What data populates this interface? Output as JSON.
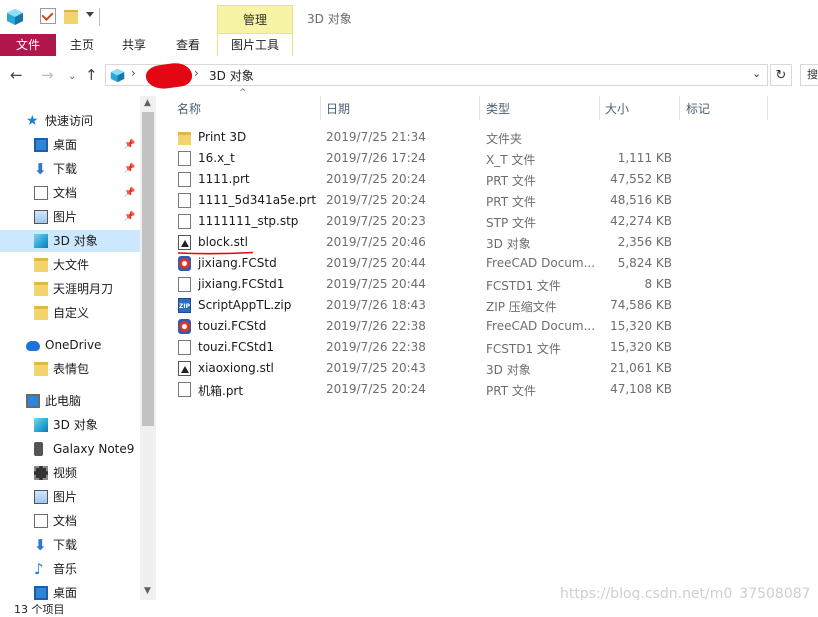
{
  "window": {
    "title": "3D 对象",
    "contextual_tab": "管理"
  },
  "ribbon": {
    "tabs": [
      "文件",
      "主页",
      "共享",
      "查看",
      "图片工具"
    ]
  },
  "address": {
    "path_current": "3D 对象"
  },
  "nav": {
    "items": [
      {
        "label": "快速访问",
        "icon": "star-icon"
      },
      {
        "label": "桌面",
        "icon": "desktop-icon",
        "pinned": true
      },
      {
        "label": "下载",
        "icon": "download-icon",
        "pinned": true
      },
      {
        "label": "文档",
        "icon": "document-icon",
        "pinned": true
      },
      {
        "label": "图片",
        "icon": "picture-icon",
        "pinned": true
      },
      {
        "label": "3D 对象",
        "icon": "cube-icon",
        "selected": true
      },
      {
        "label": "大文件",
        "icon": "folder-icon"
      },
      {
        "label": "天涯明月刀",
        "icon": "folder-icon"
      },
      {
        "label": "自定义",
        "icon": "folder-icon"
      },
      {
        "label": "OneDrive",
        "icon": "cloud-icon"
      },
      {
        "label": "表情包",
        "icon": "folder-icon"
      },
      {
        "label": "此电脑",
        "icon": "computer-icon"
      },
      {
        "label": "3D 对象",
        "icon": "cube-icon"
      },
      {
        "label": "Galaxy Note9",
        "icon": "phone-icon"
      },
      {
        "label": "视频",
        "icon": "video-icon"
      },
      {
        "label": "图片",
        "icon": "picture-icon"
      },
      {
        "label": "文档",
        "icon": "document-icon"
      },
      {
        "label": "下载",
        "icon": "download-icon"
      },
      {
        "label": "音乐",
        "icon": "music-icon"
      },
      {
        "label": "桌面",
        "icon": "desktop-icon"
      }
    ]
  },
  "columns": {
    "name": "名称",
    "date": "日期",
    "type": "类型",
    "size": "大小",
    "tags": "标记"
  },
  "files": [
    {
      "name": "Print 3D",
      "date": "2019/7/25 21:34",
      "type": "文件夹",
      "size": "",
      "icon": "folder-icon"
    },
    {
      "name": "16.x_t",
      "date": "2019/7/26 17:24",
      "type": "X_T 文件",
      "size": "1,111 KB",
      "icon": "file-icon"
    },
    {
      "name": "1111.prt",
      "date": "2019/7/25 20:24",
      "type": "PRT 文件",
      "size": "47,552 KB",
      "icon": "file-icon"
    },
    {
      "name": "1111_5d341a5e.prt",
      "date": "2019/7/25 20:24",
      "type": "PRT 文件",
      "size": "48,516 KB",
      "icon": "file-icon"
    },
    {
      "name": "1111111_stp.stp",
      "date": "2019/7/25 20:23",
      "type": "STP 文件",
      "size": "42,274 KB",
      "icon": "file-icon"
    },
    {
      "name": "block.stl",
      "date": "2019/7/25 20:46",
      "type": "3D 对象",
      "size": "2,356 KB",
      "icon": "stl-icon"
    },
    {
      "name": "jixiang.FCStd",
      "date": "2019/7/25 20:44",
      "type": "FreeCAD Docum...",
      "size": "5,824 KB",
      "icon": "freecad-icon"
    },
    {
      "name": "jixiang.FCStd1",
      "date": "2019/7/25 20:44",
      "type": "FCSTD1 文件",
      "size": "8 KB",
      "icon": "file-icon"
    },
    {
      "name": "ScriptAppTL.zip",
      "date": "2019/7/26 18:43",
      "type": "ZIP 压缩文件",
      "size": "74,586 KB",
      "icon": "zip-icon"
    },
    {
      "name": "touzi.FCStd",
      "date": "2019/7/26 22:38",
      "type": "FreeCAD Docum...",
      "size": "15,320 KB",
      "icon": "freecad-icon"
    },
    {
      "name": "touzi.FCStd1",
      "date": "2019/7/26 22:38",
      "type": "FCSTD1 文件",
      "size": "15,320 KB",
      "icon": "file-icon"
    },
    {
      "name": "xiaoxiong.stl",
      "date": "2019/7/25 20:43",
      "type": "3D 对象",
      "size": "21,061 KB",
      "icon": "stl-icon"
    },
    {
      "name": "机箱.prt",
      "date": "2019/7/25 20:24",
      "type": "PRT 文件",
      "size": "47,108 KB",
      "icon": "file-icon"
    }
  ],
  "status": {
    "item_count": "13 个项目"
  },
  "watermark": "https://blog.csdn.net/m0_37508087",
  "colors": {
    "file_tab": "#b1174d",
    "context_tab": "#f7f4a6",
    "selection": "#cce8ff",
    "annotation": "#e30613"
  }
}
